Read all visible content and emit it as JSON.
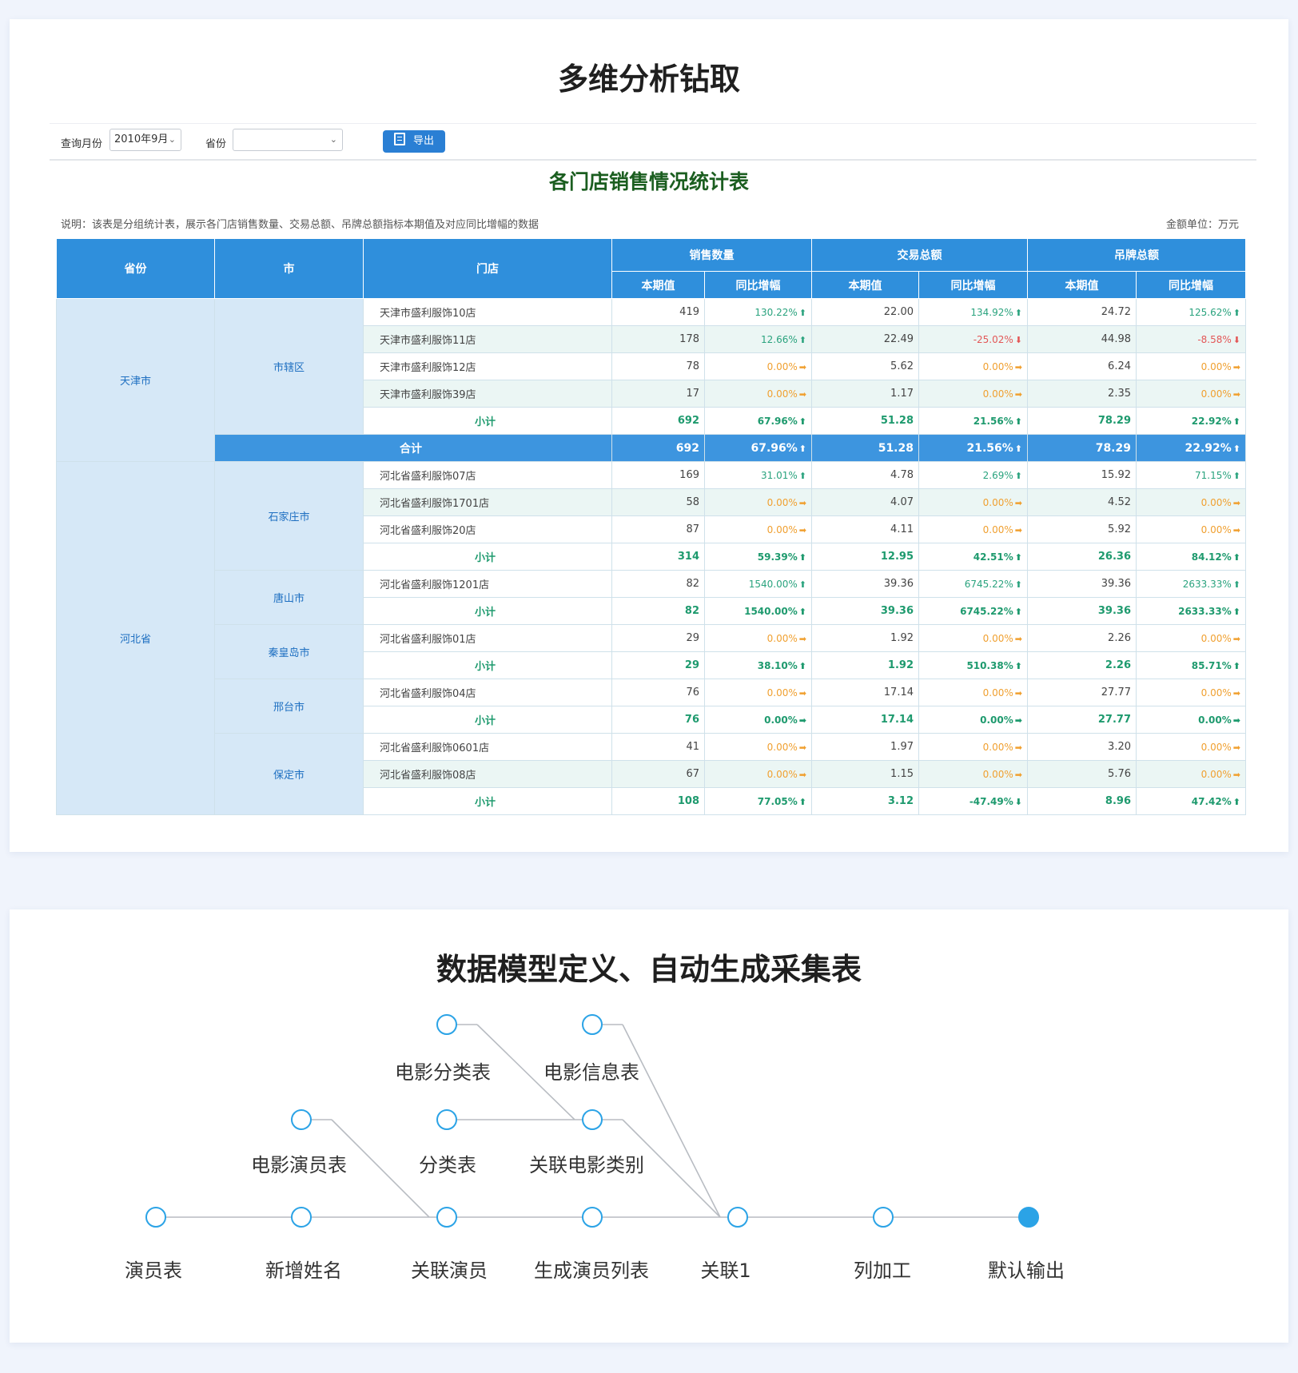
{
  "section1": {
    "title": "多维分析钻取"
  },
  "toolbar": {
    "month_label": "查询月份",
    "month_value": "2010年9月",
    "province_label": "省份",
    "province_value": "",
    "export_label": "导出"
  },
  "report": {
    "title": "各门店销售情况统计表",
    "note": "说明：该表是分组统计表，展示各门店销售数量、交易总额、吊牌总额指标本期值及对应同比增幅的数据",
    "unit": "金额单位：万元"
  },
  "table": {
    "headers": {
      "province": "省份",
      "city": "市",
      "store": "门店",
      "groups": [
        "销售数量",
        "交易总额",
        "吊牌总额"
      ],
      "current": "本期值",
      "yoy": "同比增幅"
    },
    "colors": {
      "up": "#2aa37e",
      "down": "#e35757",
      "flat": "#f0a030",
      "header": "#2f8fdc"
    },
    "rows": [
      {
        "type": "data",
        "province": "天津市",
        "province_span": 6,
        "city": "市辖区",
        "city_span": 5,
        "store": "天津市盛利服饰10店",
        "qty": "419",
        "qty_pct": "130.22%",
        "qty_dir": "up",
        "amt": "22.00",
        "amt_pct": "134.92%",
        "amt_dir": "up",
        "tag": "24.72",
        "tag_pct": "125.62%",
        "tag_dir": "up"
      },
      {
        "type": "data",
        "store": "天津市盛利服饰11店",
        "qty": "178",
        "qty_pct": "12.66%",
        "qty_dir": "up",
        "amt": "22.49",
        "amt_pct": "-25.02%",
        "amt_dir": "down",
        "tag": "44.98",
        "tag_pct": "-8.58%",
        "tag_dir": "down"
      },
      {
        "type": "data",
        "store": "天津市盛利服饰12店",
        "qty": "78",
        "qty_pct": "0.00%",
        "qty_dir": "flat",
        "amt": "5.62",
        "amt_pct": "0.00%",
        "amt_dir": "flat",
        "tag": "6.24",
        "tag_pct": "0.00%",
        "tag_dir": "flat"
      },
      {
        "type": "data",
        "store": "天津市盛利服饰39店",
        "qty": "17",
        "qty_pct": "0.00%",
        "qty_dir": "flat",
        "amt": "1.17",
        "amt_pct": "0.00%",
        "amt_dir": "flat",
        "tag": "2.35",
        "tag_pct": "0.00%",
        "tag_dir": "flat"
      },
      {
        "type": "sub",
        "store": "小计",
        "qty": "692",
        "qty_pct": "67.96%",
        "qty_dir": "up",
        "amt": "51.28",
        "amt_pct": "21.56%",
        "amt_dir": "up",
        "tag": "78.29",
        "tag_pct": "22.92%",
        "tag_dir": "up"
      },
      {
        "type": "total",
        "store": "合计",
        "qty": "692",
        "qty_pct": "67.96%",
        "qty_dir": "up",
        "amt": "51.28",
        "amt_pct": "21.56%",
        "amt_dir": "up",
        "tag": "78.29",
        "tag_pct": "22.92%",
        "tag_dir": "up"
      },
      {
        "type": "data",
        "province": "河北省",
        "province_span": 13,
        "city": "石家庄市",
        "city_span": 4,
        "store": "河北省盛利服饰07店",
        "qty": "169",
        "qty_pct": "31.01%",
        "qty_dir": "up",
        "amt": "4.78",
        "amt_pct": "2.69%",
        "amt_dir": "up",
        "tag": "15.92",
        "tag_pct": "71.15%",
        "tag_dir": "up"
      },
      {
        "type": "data",
        "store": "河北省盛利服饰1701店",
        "qty": "58",
        "qty_pct": "0.00%",
        "qty_dir": "flat",
        "amt": "4.07",
        "amt_pct": "0.00%",
        "amt_dir": "flat",
        "tag": "4.52",
        "tag_pct": "0.00%",
        "tag_dir": "flat"
      },
      {
        "type": "data",
        "store": "河北省盛利服饰20店",
        "qty": "87",
        "qty_pct": "0.00%",
        "qty_dir": "flat",
        "amt": "4.11",
        "amt_pct": "0.00%",
        "amt_dir": "flat",
        "tag": "5.92",
        "tag_pct": "0.00%",
        "tag_dir": "flat"
      },
      {
        "type": "sub",
        "store": "小计",
        "qty": "314",
        "qty_pct": "59.39%",
        "qty_dir": "up",
        "amt": "12.95",
        "amt_pct": "42.51%",
        "amt_dir": "up",
        "tag": "26.36",
        "tag_pct": "84.12%",
        "tag_dir": "up"
      },
      {
        "type": "data",
        "city": "唐山市",
        "city_span": 2,
        "store": "河北省盛利服饰1201店",
        "qty": "82",
        "qty_pct": "1540.00%",
        "qty_dir": "up",
        "amt": "39.36",
        "amt_pct": "6745.22%",
        "amt_dir": "up",
        "tag": "39.36",
        "tag_pct": "2633.33%",
        "tag_dir": "up"
      },
      {
        "type": "sub",
        "store": "小计",
        "qty": "82",
        "qty_pct": "1540.00%",
        "qty_dir": "up",
        "amt": "39.36",
        "amt_pct": "6745.22%",
        "amt_dir": "up",
        "tag": "39.36",
        "tag_pct": "2633.33%",
        "tag_dir": "up"
      },
      {
        "type": "data",
        "city": "秦皇岛市",
        "city_span": 2,
        "store": "河北省盛利服饰01店",
        "qty": "29",
        "qty_pct": "0.00%",
        "qty_dir": "flat",
        "amt": "1.92",
        "amt_pct": "0.00%",
        "amt_dir": "flat",
        "tag": "2.26",
        "tag_pct": "0.00%",
        "tag_dir": "flat"
      },
      {
        "type": "sub",
        "store": "小计",
        "qty": "29",
        "qty_pct": "38.10%",
        "qty_dir": "up",
        "amt": "1.92",
        "amt_pct": "510.38%",
        "amt_dir": "up",
        "tag": "2.26",
        "tag_pct": "85.71%",
        "tag_dir": "up"
      },
      {
        "type": "data",
        "city": "邢台市",
        "city_span": 2,
        "store": "河北省盛利服饰04店",
        "qty": "76",
        "qty_pct": "0.00%",
        "qty_dir": "flat",
        "amt": "17.14",
        "amt_pct": "0.00%",
        "amt_dir": "flat",
        "tag": "27.77",
        "tag_pct": "0.00%",
        "tag_dir": "flat"
      },
      {
        "type": "sub",
        "store": "小计",
        "qty": "76",
        "qty_pct": "0.00%",
        "qty_dir": "flat",
        "amt": "17.14",
        "amt_pct": "0.00%",
        "amt_dir": "flat",
        "tag": "27.77",
        "tag_pct": "0.00%",
        "tag_dir": "flat"
      },
      {
        "type": "data",
        "city": "保定市",
        "city_span": 3,
        "store": "河北省盛利服饰0601店",
        "qty": "41",
        "qty_pct": "0.00%",
        "qty_dir": "flat",
        "amt": "1.97",
        "amt_pct": "0.00%",
        "amt_dir": "flat",
        "tag": "3.20",
        "tag_pct": "0.00%",
        "tag_dir": "flat"
      },
      {
        "type": "data",
        "store": "河北省盛利服饰08店",
        "qty": "67",
        "qty_pct": "0.00%",
        "qty_dir": "flat",
        "amt": "1.15",
        "amt_pct": "0.00%",
        "amt_dir": "flat",
        "tag": "5.76",
        "tag_pct": "0.00%",
        "tag_dir": "flat"
      },
      {
        "type": "sub",
        "store": "小计",
        "qty": "108",
        "qty_pct": "77.05%",
        "qty_dir": "up",
        "amt": "3.12",
        "amt_pct": "-47.49%",
        "amt_dir": "down",
        "tag": "8.96",
        "tag_pct": "47.42%",
        "tag_dir": "up"
      }
    ]
  },
  "section2": {
    "title": "数据模型定义、自动生成采集表"
  },
  "flow": {
    "nodes": [
      {
        "id": "actor_table",
        "label": "演员表",
        "filled": false
      },
      {
        "id": "add_name",
        "label": "新增姓名",
        "filled": false
      },
      {
        "id": "join_actor",
        "label": "关联演员",
        "filled": false
      },
      {
        "id": "gen_list",
        "label": "生成演员列表",
        "filled": false
      },
      {
        "id": "join1",
        "label": "关联1",
        "filled": false
      },
      {
        "id": "col_proc",
        "label": "列加工",
        "filled": false
      },
      {
        "id": "default_out",
        "label": "默认输出",
        "filled": true
      },
      {
        "id": "movie_actor",
        "label": "电影演员表",
        "filled": false
      },
      {
        "id": "category",
        "label": "分类表",
        "filled": false
      },
      {
        "id": "join_movie_cat",
        "label": "关联电影类别",
        "filled": false
      },
      {
        "id": "movie_cat",
        "label": "电影分类表",
        "filled": false
      },
      {
        "id": "movie_info",
        "label": "电影信息表",
        "filled": false
      }
    ],
    "edges": [
      [
        "actor_table",
        "add_name"
      ],
      [
        "add_name",
        "join_actor"
      ],
      [
        "join_actor",
        "gen_list"
      ],
      [
        "gen_list",
        "join1"
      ],
      [
        "join1",
        "col_proc"
      ],
      [
        "col_proc",
        "default_out"
      ],
      [
        "movie_actor",
        "join_actor"
      ],
      [
        "category",
        "join_movie_cat"
      ],
      [
        "movie_cat",
        "join_movie_cat"
      ],
      [
        "join_movie_cat",
        "join1"
      ],
      [
        "movie_info",
        "join1"
      ]
    ],
    "colors": {
      "node_stroke": "#2ba3e6",
      "node_fill_active": "#2ba3e6",
      "edge": "#b8bcc2"
    }
  }
}
